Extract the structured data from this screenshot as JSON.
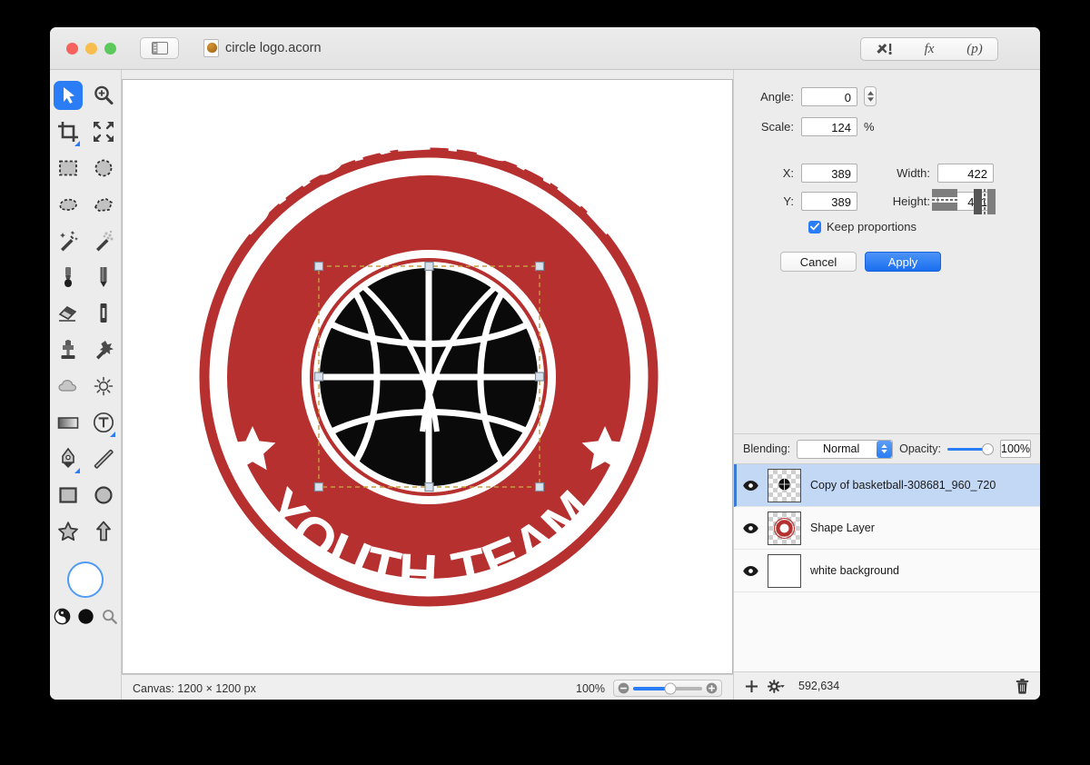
{
  "window": {
    "title": "circle logo.acorn",
    "traffic_lights": [
      "close",
      "minimize",
      "zoom"
    ],
    "sidebar_toggle": "sidebar-toggle",
    "toolbar_buttons": [
      {
        "name": "tools-palette-icon",
        "label": ""
      },
      {
        "name": "fx-filters-icon",
        "label": "fx"
      },
      {
        "name": "presets-icon",
        "label": "(p)"
      }
    ]
  },
  "tools": [
    {
      "name": "move-tool",
      "label": "Move",
      "selected": true
    },
    {
      "name": "zoom-tool",
      "label": "Zoom",
      "selected": false
    },
    {
      "name": "crop-tool",
      "label": "Crop",
      "selected": false,
      "corner": true
    },
    {
      "name": "transform-tool",
      "label": "Transform",
      "selected": false
    },
    {
      "name": "rectangle-select-tool",
      "label": "Rectangular Selection",
      "selected": false
    },
    {
      "name": "ellipse-select-tool",
      "label": "Elliptical Selection",
      "selected": false
    },
    {
      "name": "lasso-tool",
      "label": "Lasso",
      "selected": false
    },
    {
      "name": "polygon-lasso-tool",
      "label": "Polygon Lasso",
      "selected": false
    },
    {
      "name": "magic-wand-tool",
      "label": "Magic Wand",
      "selected": false
    },
    {
      "name": "instant-alpha-tool",
      "label": "Instant Alpha",
      "selected": false
    },
    {
      "name": "paint-brush-tool",
      "label": "Brush",
      "selected": false
    },
    {
      "name": "pencil-tool",
      "label": "Pencil",
      "selected": false
    },
    {
      "name": "eraser-tool",
      "label": "Eraser",
      "selected": false
    },
    {
      "name": "marker-tool",
      "label": "Marker",
      "selected": false
    },
    {
      "name": "clone-stamp-tool",
      "label": "Clone Stamp",
      "selected": false
    },
    {
      "name": "smudge-tool",
      "label": "Smudge",
      "selected": false
    },
    {
      "name": "blur-tool",
      "label": "Blur",
      "selected": false
    },
    {
      "name": "dodge-tool",
      "label": "Dodge",
      "selected": false
    },
    {
      "name": "gradient-tool",
      "label": "Gradient",
      "selected": false
    },
    {
      "name": "text-tool",
      "label": "Text",
      "selected": false,
      "corner": true
    },
    {
      "name": "bezier-pen-tool",
      "label": "Bezier Pen",
      "selected": false,
      "corner": true
    },
    {
      "name": "line-tool",
      "label": "Line",
      "selected": false
    },
    {
      "name": "rectangle-shape-tool",
      "label": "Rectangle",
      "selected": false
    },
    {
      "name": "ellipse-shape-tool",
      "label": "Ellipse",
      "selected": false
    },
    {
      "name": "star-shape-tool",
      "label": "Star",
      "selected": false
    },
    {
      "name": "arrow-shape-tool",
      "label": "Arrow",
      "selected": false
    }
  ],
  "color_controls": {
    "swatch": "#ffffff",
    "swatch_ring": "#4f9bf5",
    "contrast_icon": "contrast-icon",
    "fill_icon": "fill-color-icon",
    "loupe_icon": "loupe-icon"
  },
  "inspector": {
    "angle": {
      "label": "Angle:",
      "value": "0"
    },
    "scale": {
      "label": "Scale:",
      "value": "124",
      "unit": "%"
    },
    "x": {
      "label": "X:",
      "value": "389"
    },
    "y": {
      "label": "Y:",
      "value": "389"
    },
    "width": {
      "label": "Width:",
      "value": "422"
    },
    "height": {
      "label": "Height:",
      "value": "421"
    },
    "keep_proportions": {
      "label": "Keep proportions",
      "checked": true
    },
    "flip_horizontal": "flip-horizontal-icon",
    "flip_vertical": "flip-vertical-icon",
    "cancel": "Cancel",
    "apply": "Apply"
  },
  "blending": {
    "label": "Blending:",
    "mode": "Normal",
    "opacity_label": "Opacity:",
    "opacity_value": "100%",
    "opacity_percent": 100
  },
  "layers": [
    {
      "name": "Copy of basketball-308681_960_720",
      "visible": true,
      "selected": true,
      "thumb": "basketball"
    },
    {
      "name": "Shape Layer",
      "visible": true,
      "selected": false,
      "thumb": "badge"
    },
    {
      "name": "white background",
      "visible": true,
      "selected": false,
      "thumb": "white"
    }
  ],
  "layer_toolbar": {
    "add": "+",
    "settings": "gear",
    "count": "592,634",
    "delete": "trash"
  },
  "status": {
    "canvas": "Canvas: 1200 × 1200 px",
    "zoom": "100%",
    "zoom_percent": 54
  },
  "artwork": {
    "title_top": "BASKETBALL",
    "title_bottom": "YOUTH TEAM",
    "red": "#b5302f",
    "black": "#0a0a0a",
    "white": "#ffffff",
    "selection_handle_color": "#b9c6d6",
    "selection_box_color": "#c79a3e"
  }
}
